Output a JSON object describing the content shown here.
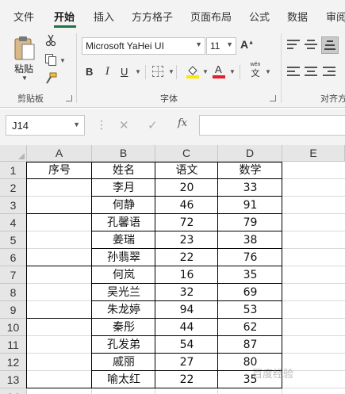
{
  "ribbon_tabs": [
    "文件",
    "开始",
    "插入",
    "方方格子",
    "页面布局",
    "公式",
    "数据",
    "审阅"
  ],
  "clipboard": {
    "paste_label": "粘贴",
    "group_label": "剪贴板"
  },
  "font": {
    "family": "Microsoft YaHei UI",
    "size": "11",
    "group_label": "字体",
    "bold": "B",
    "italic": "I",
    "underline": "U",
    "phonetic_top": "wén",
    "phonetic_bottom": "文"
  },
  "alignment": {
    "group_label": "对齐方"
  },
  "formula_bar": {
    "name_box": "J14",
    "fx": "fx",
    "cancel": "✕",
    "enter": "✓",
    "formula": ""
  },
  "columns": [
    "A",
    "B",
    "C",
    "D",
    "E"
  ],
  "rows": [
    "1",
    "2",
    "3",
    "4",
    "5",
    "6",
    "7",
    "8",
    "9",
    "10",
    "11",
    "12",
    "13",
    "14"
  ],
  "table": {
    "headers": [
      "序号",
      "姓名",
      "语文",
      "数学"
    ],
    "records": [
      {
        "name": "李月",
        "chinese": "20",
        "math": "33"
      },
      {
        "name": "何静",
        "chinese": "46",
        "math": "91"
      },
      {
        "name": "孔馨语",
        "chinese": "72",
        "math": "79"
      },
      {
        "name": "姜瑞",
        "chinese": "23",
        "math": "38"
      },
      {
        "name": "孙翡翠",
        "chinese": "22",
        "math": "76"
      },
      {
        "name": "何岚",
        "chinese": "16",
        "math": "35"
      },
      {
        "name": "吴光兰",
        "chinese": "32",
        "math": "69"
      },
      {
        "name": "朱龙婷",
        "chinese": "94",
        "math": "53"
      },
      {
        "name": "秦彤",
        "chinese": "44",
        "math": "62"
      },
      {
        "name": "孔发弟",
        "chinese": "54",
        "math": "87"
      },
      {
        "name": "戚丽",
        "chinese": "27",
        "math": "80"
      },
      {
        "name": "喻太红",
        "chinese": "22",
        "math": "35"
      }
    ]
  },
  "watermark": "百度经验",
  "colors": {
    "accent": "#217346",
    "font_color": "#e0202a",
    "highlight": "#ffe800"
  }
}
